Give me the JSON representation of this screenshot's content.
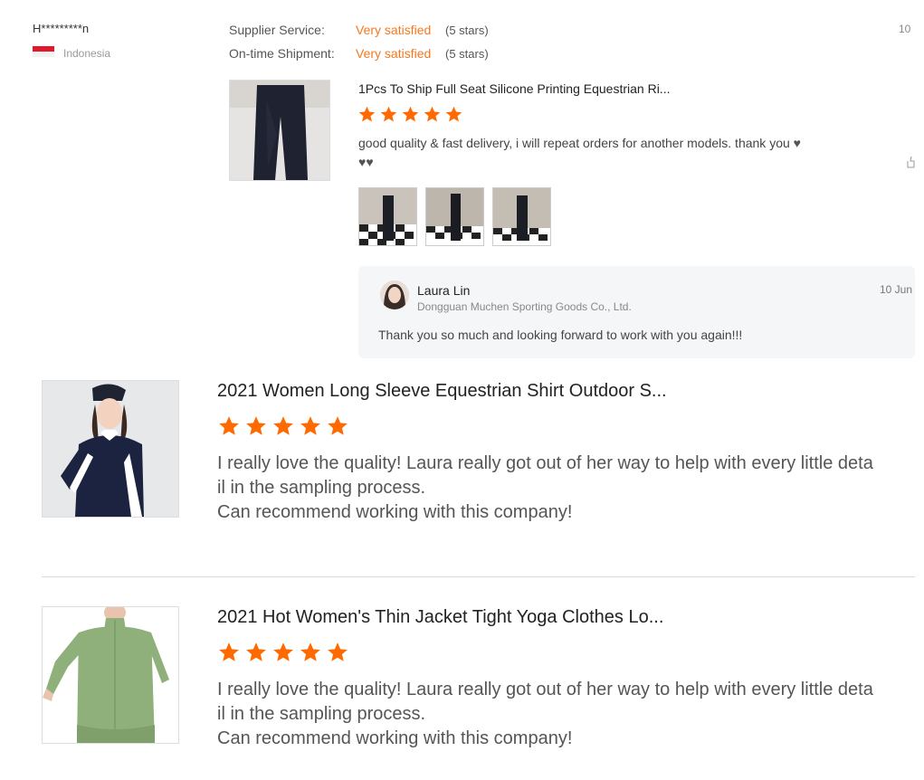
{
  "top_review": {
    "user": "H*********n",
    "country": "Indonesia",
    "date": "10",
    "supplier_service": {
      "label": "Supplier Service:",
      "value": "Very satisfied",
      "stars": "(5 stars)"
    },
    "on_time_shipment": {
      "label": "On-time Shipment:",
      "value": "Very satisfied",
      "stars": "(5 stars)"
    },
    "product_title": "1Pcs To Ship Full Seat Silicone Printing Equestrian Ri...",
    "rating": 5,
    "text_line1": "good quality & fast delivery, i will repeat orders for another models. thank you ",
    "hearts_line1": "♥",
    "hearts_line2": "♥♥",
    "photos_count": 3,
    "reply": {
      "name": "Laura Lin",
      "company": "Dongguan Muchen Sporting Goods Co., Ltd.",
      "date": "10 Jun",
      "text": "Thank you so much and looking forward to work with you again!!!"
    }
  },
  "reviews": [
    {
      "title": "2021 Women Long Sleeve Equestrian Shirt Outdoor S...",
      "rating": 5,
      "line1": "I really love the quality! Laura really got out of her way to help with every little deta",
      "line2": "il in the sampling process.",
      "line3": "Can recommend working with this company!"
    },
    {
      "title": "2021 Hot Women's Thin Jacket Tight Yoga Clothes Lo...",
      "rating": 5,
      "line1": "I really love the quality! Laura really got out of her way to help with every little deta",
      "line2": "il in the sampling process.",
      "line3": "Can recommend working with this company!"
    }
  ],
  "colors": {
    "accent": "#f5781f",
    "star": "#ff6a00"
  }
}
